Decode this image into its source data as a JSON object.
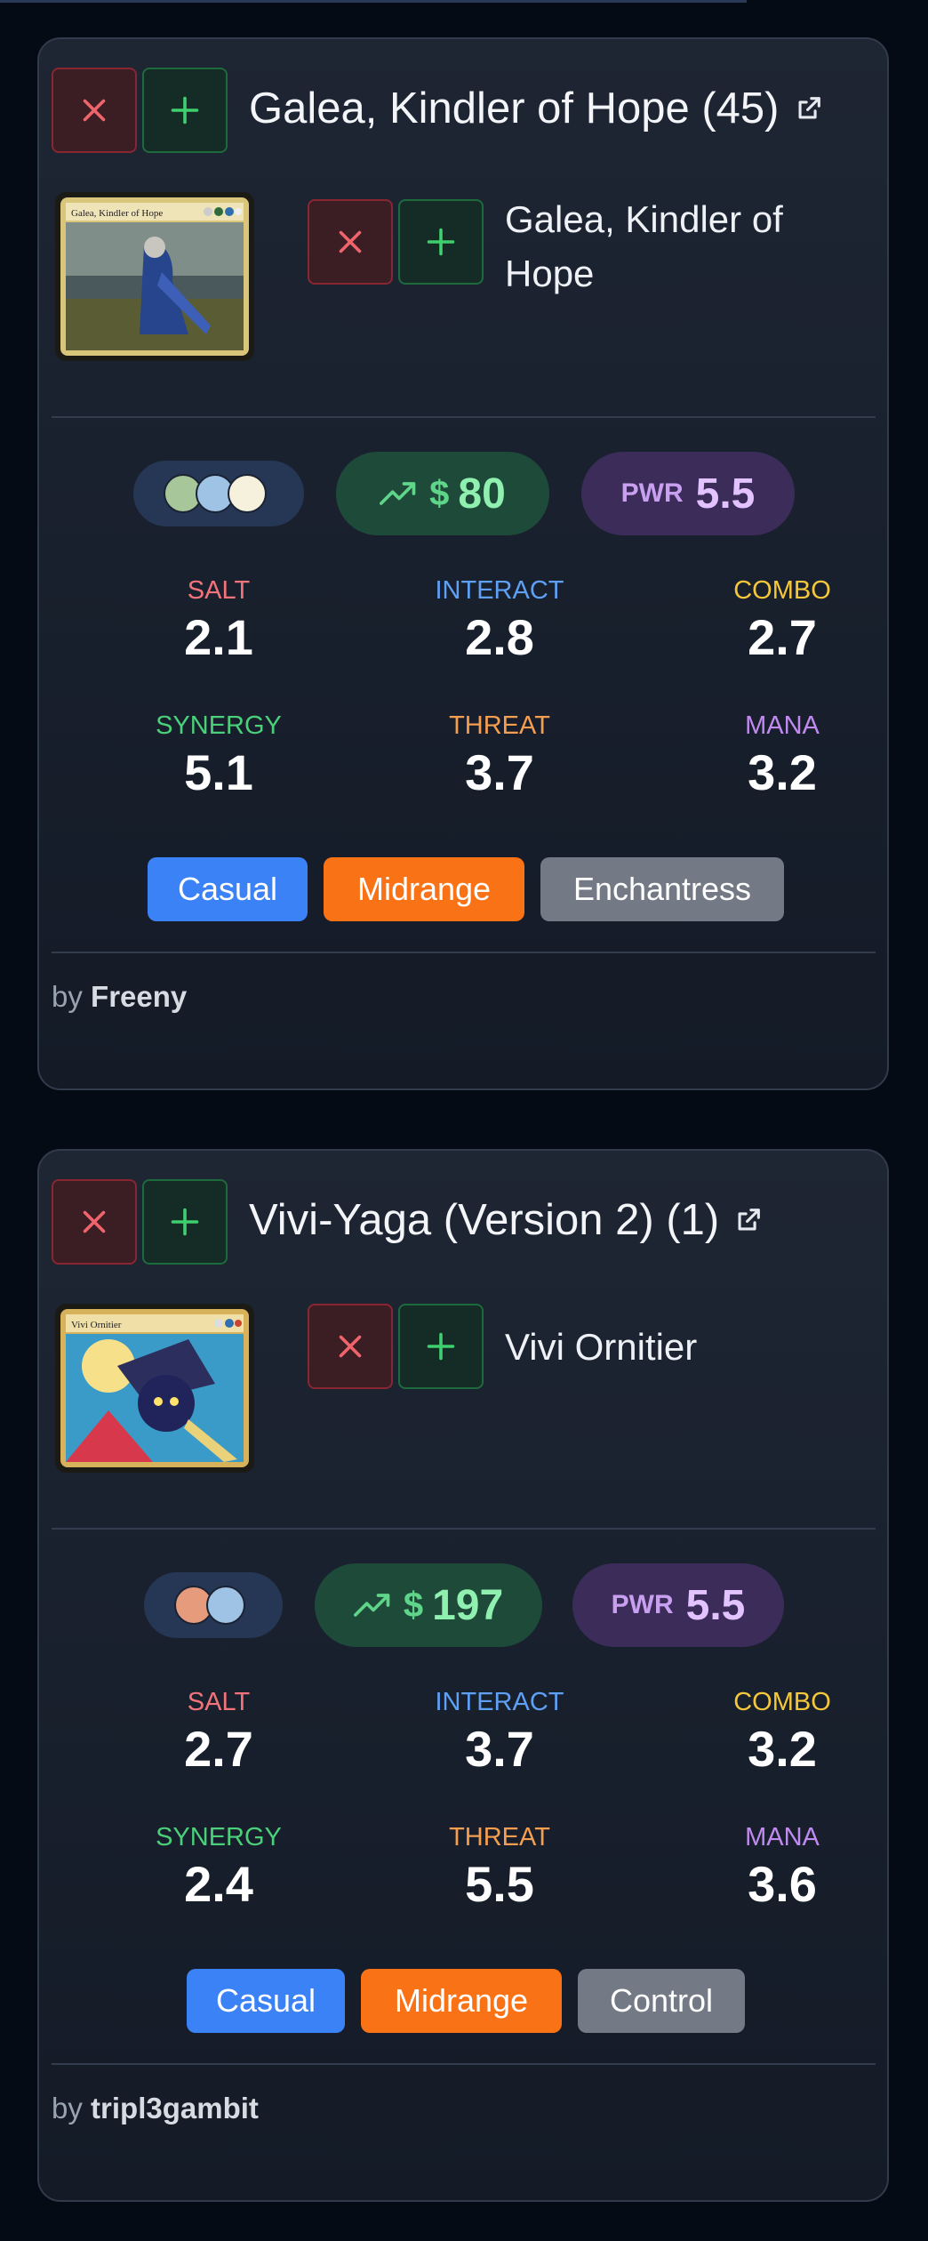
{
  "decks": [
    {
      "title": "Galea, Kindler of Hope (45)",
      "commander": "Galea, Kindler of Hope",
      "art_title": "Galea, Kindler of Hope",
      "colors": [
        "green",
        "blue",
        "white"
      ],
      "price_symbol": "$",
      "price": "80",
      "pwr_label": "PWR",
      "pwr": "5.5",
      "stats": {
        "salt_label": "SALT",
        "salt": "2.1",
        "interact_label": "INTERACT",
        "interact": "2.8",
        "combo_label": "COMBO",
        "combo": "2.7",
        "synergy_label": "SYNERGY",
        "synergy": "5.1",
        "threat_label": "THREAT",
        "threat": "3.7",
        "mana_label": "MANA",
        "mana": "3.2"
      },
      "tags": [
        "Casual",
        "Midrange",
        "Enchantress"
      ],
      "by": "by",
      "author": "Freeny"
    },
    {
      "title": "Vivi-Yaga (Version 2) (1)",
      "commander": "Vivi Ornitier",
      "art_title": "Vivi Ornitier",
      "colors": [
        "red",
        "blue"
      ],
      "price_symbol": "$",
      "price": "197",
      "pwr_label": "PWR",
      "pwr": "5.5",
      "stats": {
        "salt_label": "SALT",
        "salt": "2.7",
        "interact_label": "INTERACT",
        "interact": "3.7",
        "combo_label": "COMBO",
        "combo": "3.2",
        "synergy_label": "SYNERGY",
        "synergy": "2.4",
        "threat_label": "THREAT",
        "threat": "5.5",
        "mana_label": "MANA",
        "mana": "3.6"
      },
      "tags": [
        "Casual",
        "Midrange",
        "Control"
      ],
      "by": "by",
      "author": "tripl3gambit"
    }
  ],
  "icons": {
    "remove": "x-icon",
    "add": "plus-icon",
    "external": "external-link-icon",
    "trend": "trending-up-icon"
  },
  "accent_colors": {
    "salt": "#f2737a",
    "interact": "#5ea0f5",
    "combo": "#f5c73a",
    "synergy": "#4bd07a",
    "threat": "#f59e50",
    "mana": "#c08af0"
  }
}
